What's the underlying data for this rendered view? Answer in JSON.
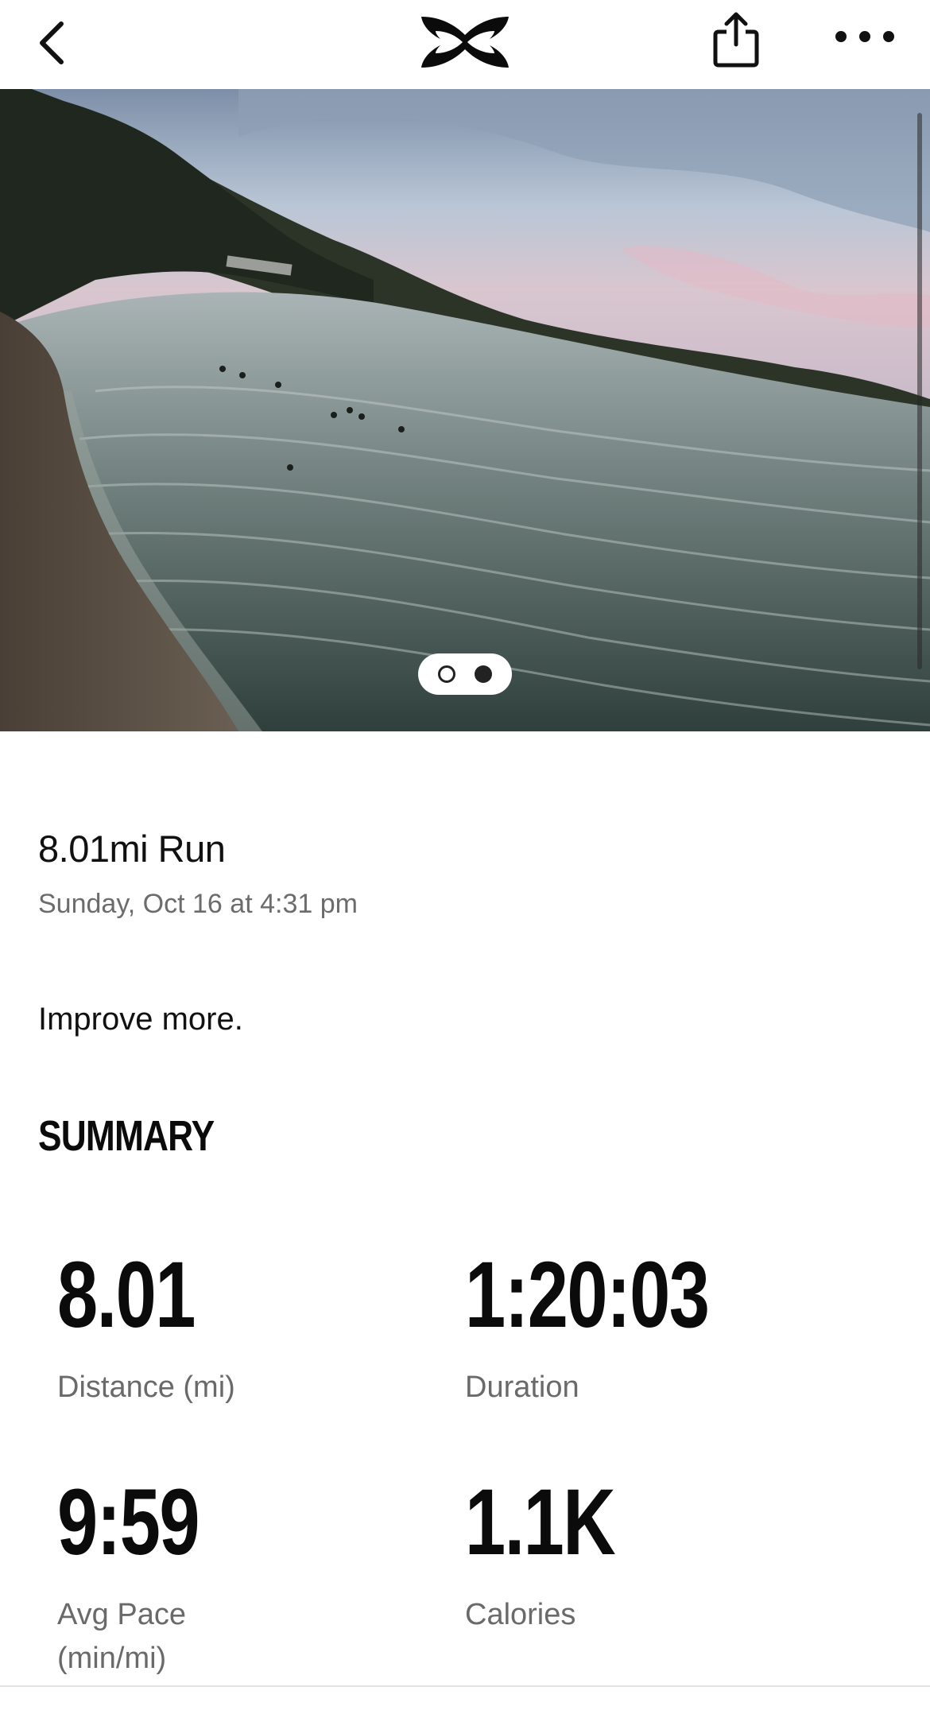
{
  "navbar": {
    "back_icon": "chevron-left-icon",
    "logo_icon": "under-armour-logo",
    "share_icon": "share-icon",
    "more_icon": "more-horizontal-icon"
  },
  "hero": {
    "pager": {
      "total": 2,
      "active": 2
    }
  },
  "activity": {
    "title": "8.01mi Run",
    "date": "Sunday, Oct 16 at 4:31 pm",
    "note": "Improve more."
  },
  "summary": {
    "heading": "SUMMARY",
    "stats": [
      {
        "value": "8.01",
        "label": "Distance (mi)"
      },
      {
        "value": "1:20:03",
        "label": "Duration"
      },
      {
        "value": "9:59",
        "label": "Avg Pace (min/mi)"
      },
      {
        "value": "1.1K",
        "label": "Calories"
      }
    ]
  },
  "colors": {
    "text": "#111111",
    "muted": "#6a6a6a",
    "background": "#ffffff"
  }
}
